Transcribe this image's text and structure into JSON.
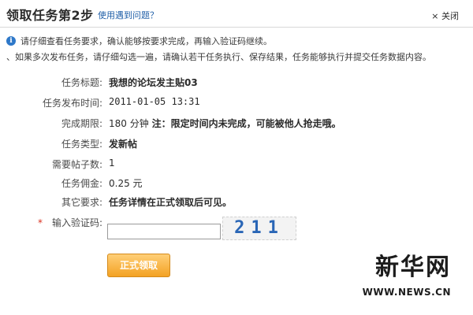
{
  "header": {
    "title": "领取任务第2步",
    "help_link": "使用遇到问题？",
    "close": "× 关闭"
  },
  "info": {
    "line1": "请仔细查看任务要求，确认能够按要求完成，再输入验证码继续。",
    "line2": "、如果多次发布任务，请仔细勾选一遍，请确认若干任务执行、保存结果，任务能够执行并提交任务数据内容。"
  },
  "form": {
    "rows": [
      {
        "label": "任务标题:",
        "value": "我想的论坛发主贴03"
      },
      {
        "label": "任务发布时间:",
        "value": "2011-01-05 13:31"
      },
      {
        "label": "完成期限:",
        "value": "180 分钟",
        "note": "注：限定时间内未完成，可能被他人抢走哦。"
      },
      {
        "label": "任务类型:",
        "value": "发新帖"
      },
      {
        "label": "需要帖子数:",
        "value": "1"
      },
      {
        "label": "任务佣金:",
        "value": "0.25 元"
      },
      {
        "label": "其它要求:",
        "value": "任务详情在正式领取后可见。"
      }
    ],
    "captcha": {
      "label": "输入验证码:",
      "value": "",
      "image_text": "211"
    },
    "submit": "正式领取"
  },
  "watermark": {
    "cn": "新华网",
    "en": "WWW.NEWS.CN"
  },
  "colors": {
    "link": "#1f5fa8",
    "button": "#f3a224",
    "required": "#d9301f"
  }
}
